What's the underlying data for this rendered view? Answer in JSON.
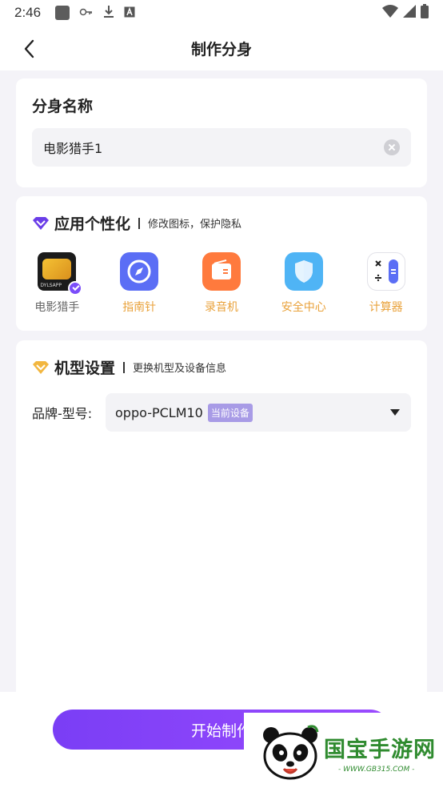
{
  "status_bar": {
    "time": "2:46",
    "icons_left": [
      "square-icon",
      "key-icon",
      "download-icon",
      "a-icon"
    ],
    "icons_right": [
      "wifi-icon",
      "signal-icon",
      "battery-icon"
    ]
  },
  "header": {
    "title": "制作分身",
    "back_icon": "chevron-left-icon"
  },
  "clone_name": {
    "section_title": "分身名称",
    "input_value": "电影猎手1"
  },
  "personalization": {
    "title": "应用个性化",
    "subtitle": "修改图标，保护隐私",
    "apps": [
      {
        "label": "电影猎手",
        "icon": "movie-hunter-icon",
        "selected": true,
        "movie_icon_text": "DYLSAPP"
      },
      {
        "label": "指南针",
        "icon": "compass-icon",
        "selected": false
      },
      {
        "label": "录音机",
        "icon": "recorder-icon",
        "selected": false
      },
      {
        "label": "安全中心",
        "icon": "shield-icon",
        "selected": false
      },
      {
        "label": "计算器",
        "icon": "calculator-icon",
        "selected": false
      }
    ]
  },
  "model_settings": {
    "title": "机型设置",
    "subtitle": "更换机型及设备信息",
    "brand_label": "品牌-型号:",
    "brand_value": "oppo-PCLM10",
    "current_badge": "当前设备"
  },
  "start_button": {
    "label": "开始制作"
  },
  "watermark": {
    "text": "国宝手游网",
    "url": "- WWW.GB315.COM -"
  },
  "colors": {
    "accent": "#7b4dfa",
    "orange_label": "#e9a23b",
    "background": "#f4f3f8",
    "watermark_green": "#2f8b2f"
  }
}
